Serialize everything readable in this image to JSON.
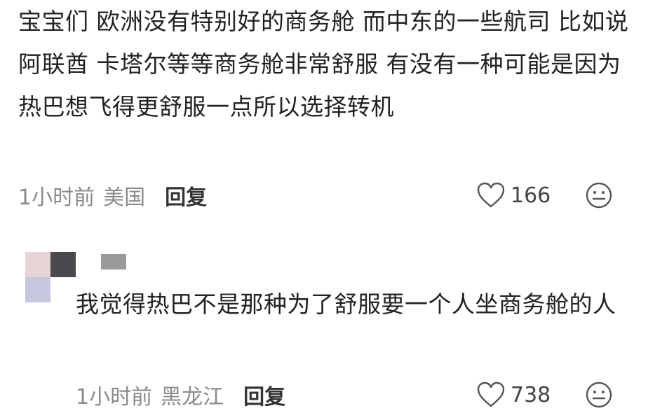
{
  "comments": [
    {
      "text": "宝宝们 欧洲没有特别好的商务舱 而中东的一些航司 比如说阿联酋 卡塔尔等等商务舱非常舒服 有没有一种可能是因为热巴想飞得更舒服一点所以选择转机",
      "time": "1小时前",
      "location": "美国",
      "reply_label": "回复",
      "likes": "166"
    },
    {
      "text": "我觉得热巴不是那种为了舒服要一个人坐商务舱的人",
      "time": "1小时前",
      "location": "黑龙江",
      "reply_label": "回复",
      "likes": "738",
      "avatar_colors": [
        "#e6d3d6",
        "#4a4a4e",
        "#c5c8e0",
        "#ffffff"
      ],
      "username_redacted_color": "#9a9a9a"
    }
  ],
  "icons": {
    "like": "heart-outline-icon",
    "reaction": "smiley-face-icon"
  }
}
